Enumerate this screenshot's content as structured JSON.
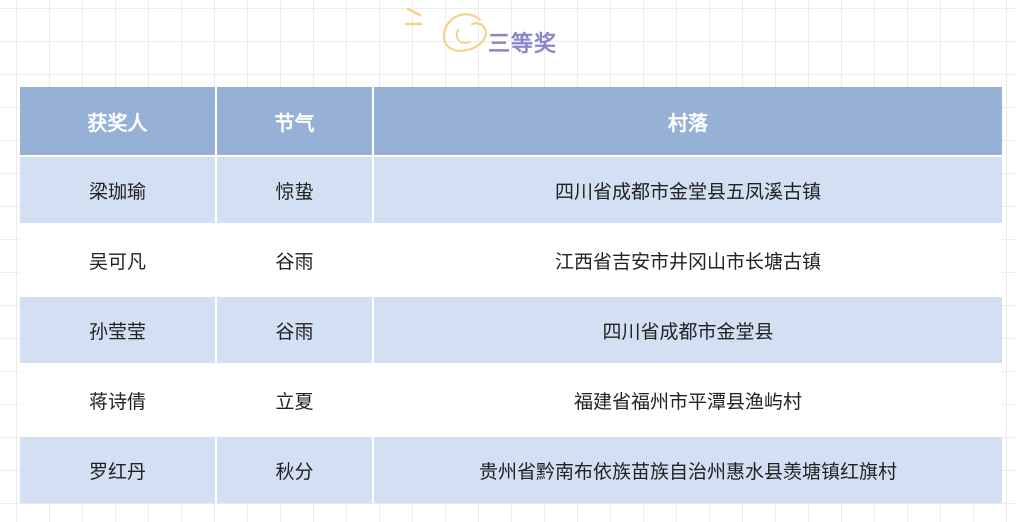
{
  "heading": {
    "title": "三等奖",
    "icon": "swirl-doodle-icon",
    "accent_color": "#8a86c8",
    "doodle_color": "#f3d48a"
  },
  "table": {
    "header_color": "#97b0d6",
    "band_color": "#d3dff3",
    "columns": [
      "获奖人",
      "节气",
      "村落"
    ],
    "rows": [
      {
        "winner": "梁珈瑜",
        "solar_term": "惊蛰",
        "village": "四川省成都市金堂县五凤溪古镇"
      },
      {
        "winner": "吴可凡",
        "solar_term": "谷雨",
        "village": "江西省吉安市井冈山市长塘古镇"
      },
      {
        "winner": "孙莹莹",
        "solar_term": "谷雨",
        "village": "四川省成都市金堂县"
      },
      {
        "winner": "蒋诗倩",
        "solar_term": "立夏",
        "village": "福建省福州市平潭县渔屿村"
      },
      {
        "winner": "罗红丹",
        "solar_term": "秋分",
        "village": "贵州省黔南布依族苗族自治州惠水县羡塘镇红旗村"
      }
    ]
  }
}
